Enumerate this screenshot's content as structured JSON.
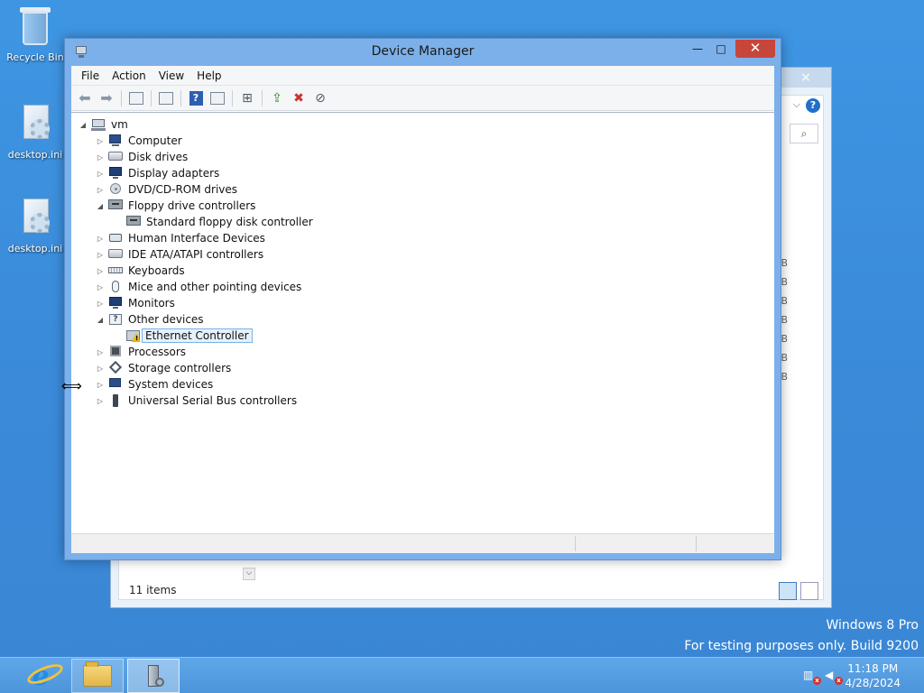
{
  "desktop": {
    "icons": [
      {
        "label": "Recycle Bin"
      },
      {
        "label": "desktop.ini"
      },
      {
        "label": "desktop.ini"
      }
    ]
  },
  "background_window": {
    "status_items": "11 items",
    "size_column": [
      "B",
      "B",
      "B",
      "B",
      "B",
      "B",
      "B"
    ],
    "close_glyph": "×"
  },
  "device_manager": {
    "title": "Device Manager",
    "menu": [
      "File",
      "Action",
      "View",
      "Help"
    ],
    "window_buttons": {
      "minimize": "—",
      "maximize": "□",
      "close": "✕"
    },
    "tree": {
      "root": "vm",
      "nodes": [
        {
          "label": "Computer",
          "expanded": false
        },
        {
          "label": "Disk drives",
          "expanded": false
        },
        {
          "label": "Display adapters",
          "expanded": false
        },
        {
          "label": "DVD/CD-ROM drives",
          "expanded": false
        },
        {
          "label": "Floppy drive controllers",
          "expanded": true,
          "children": [
            "Standard floppy disk controller"
          ]
        },
        {
          "label": "Human Interface Devices",
          "expanded": false
        },
        {
          "label": "IDE ATA/ATAPI controllers",
          "expanded": false
        },
        {
          "label": "Keyboards",
          "expanded": false
        },
        {
          "label": "Mice and other pointing devices",
          "expanded": false
        },
        {
          "label": "Monitors",
          "expanded": false
        },
        {
          "label": "Other devices",
          "expanded": true,
          "children": [
            "Ethernet Controller"
          ]
        },
        {
          "label": "Processors",
          "expanded": false
        },
        {
          "label": "Storage controllers",
          "expanded": false
        },
        {
          "label": "System devices",
          "expanded": false
        },
        {
          "label": "Universal Serial Bus controllers",
          "expanded": false
        }
      ],
      "selected": "Ethernet Controller"
    }
  },
  "watermark": {
    "line1": "Windows 8 Pro",
    "line2": "For testing purposes only. Build 9200"
  },
  "taskbar": {
    "time": "11:18 PM",
    "date": "4/28/2024"
  }
}
